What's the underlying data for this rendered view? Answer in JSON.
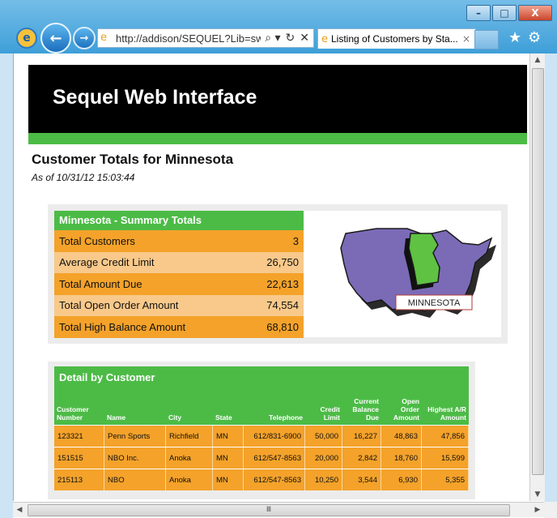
{
  "browser": {
    "url": "http://addison/SEQUEL?Lib=swi",
    "tab_title": "Listing of Customers by Sta...",
    "tab_close": "×",
    "window": {
      "minimize": "–",
      "maximize": "□",
      "close": "X"
    },
    "address_tools": {
      "search": "⌕ ▾",
      "refresh": "↻",
      "stop": "✕"
    },
    "favorites_icon": "★",
    "tools_icon": "⚙",
    "hscroll_grip": "Ⅲ"
  },
  "page": {
    "banner_title": "Sequel Web Interface",
    "title": "Customer Totals for Minnesota",
    "timestamp": "As of 10/31/12 15:03:44"
  },
  "summary": {
    "heading": "Minnesota - Summary Totals",
    "rows": [
      {
        "label": "Total Customers",
        "value": "3"
      },
      {
        "label": "Average Credit Limit",
        "value": "26,750"
      },
      {
        "label": "Total Amount Due",
        "value": "22,613"
      },
      {
        "label": "Total Open Order Amount",
        "value": "74,554"
      },
      {
        "label": "Total High Balance Amount",
        "value": "68,810"
      }
    ],
    "map_label": "MINNESOTA"
  },
  "detail": {
    "heading": "Detail by Customer",
    "columns": [
      "Customer Number",
      "Name",
      "City",
      "State",
      "Telephone",
      "Credit Limit",
      "Current Balance Due",
      "Open Order Amount",
      "Highest A/R Amount"
    ],
    "rows": [
      [
        "123321",
        "Penn Sports",
        "Richfield",
        "MN",
        "612/831-6900",
        "50,000",
        "16,227",
        "48,863",
        "47,856"
      ],
      [
        "151515",
        "NBO Inc.",
        "Anoka",
        "MN",
        "612/547-8563",
        "20,000",
        "2,842",
        "18,760",
        "15,599"
      ],
      [
        "215113",
        "NBO",
        "Anoka",
        "MN",
        "612/547-8563",
        "10,250",
        "3,544",
        "6,930",
        "5,355"
      ]
    ]
  },
  "colors": {
    "green": "#4cbb46",
    "orange": "#f4a22a",
    "light_orange": "#f8c98a",
    "map_purple": "#7b6bb7"
  }
}
